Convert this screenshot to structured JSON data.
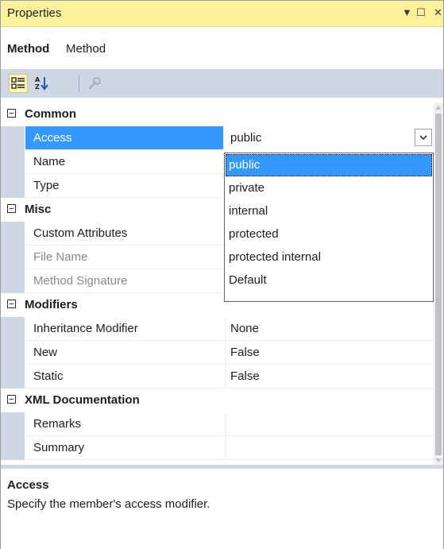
{
  "window": {
    "title": "Properties",
    "controls": {
      "dropdown": "▼",
      "maximize": "☐",
      "close": "✕"
    }
  },
  "object_selector": {
    "name": "Method",
    "type": "Method"
  },
  "toolbar": {
    "buttons": [
      {
        "icon": "categorized-icon",
        "active": true
      },
      {
        "icon": "alphabetical-icon",
        "active": false
      },
      {
        "icon": "property-pages-icon",
        "active": false
      }
    ]
  },
  "grid": {
    "categories": [
      {
        "label": "Common",
        "properties": [
          {
            "name": "Access",
            "value": "public",
            "selected": true,
            "dim": false
          },
          {
            "name": "Name",
            "value": "",
            "selected": false,
            "dim": false
          },
          {
            "name": "Type",
            "value": "",
            "selected": false,
            "dim": false
          }
        ]
      },
      {
        "label": "Misc",
        "properties": [
          {
            "name": "Custom Attributes",
            "value": "",
            "selected": false,
            "dim": false
          },
          {
            "name": "File Name",
            "value": "",
            "selected": false,
            "dim": true
          },
          {
            "name": "Method Signature",
            "value": "",
            "selected": false,
            "dim": true
          }
        ]
      },
      {
        "label": "Modifiers",
        "properties": [
          {
            "name": "Inheritance Modifier",
            "value": "None",
            "selected": false,
            "dim": false
          },
          {
            "name": "New",
            "value": "False",
            "selected": false,
            "dim": false
          },
          {
            "name": "Static",
            "value": "False",
            "selected": false,
            "dim": false
          }
        ]
      },
      {
        "label": "XML Documentation",
        "properties": [
          {
            "name": "Remarks",
            "value": "",
            "selected": false,
            "dim": false
          },
          {
            "name": "Summary",
            "value": "",
            "selected": false,
            "dim": false
          }
        ]
      }
    ]
  },
  "access_dropdown": {
    "selected": "public",
    "options": [
      "public",
      "private",
      "internal",
      "protected",
      "protected internal",
      "Default"
    ]
  },
  "description": {
    "title": "Access",
    "text": "Specify the member's access modifier."
  },
  "colors": {
    "title_bar": "#fff29d",
    "toolbar": "#cfd6e5",
    "selection": "#3399ff"
  }
}
